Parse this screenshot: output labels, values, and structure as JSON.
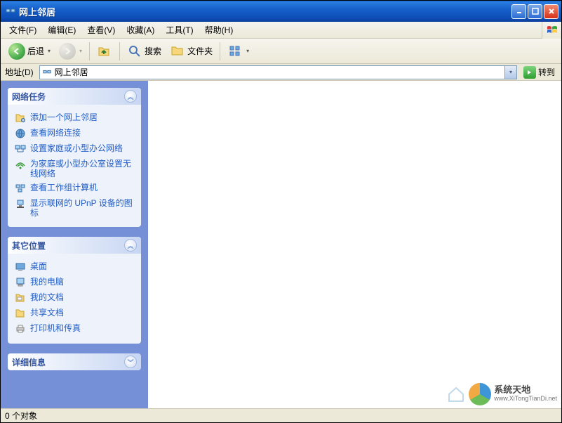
{
  "titlebar": {
    "title": "网上邻居"
  },
  "menu": {
    "file": "文件(F)",
    "edit": "编辑(E)",
    "view": "查看(V)",
    "favorites": "收藏(A)",
    "tools": "工具(T)",
    "help": "帮助(H)"
  },
  "toolbar": {
    "back": "后退",
    "search": "搜索",
    "folders": "文件夹"
  },
  "addressbar": {
    "label": "地址(D)",
    "value": "网上邻居",
    "go": "转到"
  },
  "panels": {
    "network": {
      "title": "网络任务",
      "items": [
        "添加一个网上邻居",
        "查看网络连接",
        "设置家庭或小型办公网络",
        "为家庭或小型办公室设置无线网络",
        "查看工作组计算机",
        "显示联网的 UPnP 设备的图标"
      ]
    },
    "other": {
      "title": "其它位置",
      "items": [
        "桌面",
        "我的电脑",
        "我的文档",
        "共享文档",
        "打印机和传真"
      ]
    },
    "details": {
      "title": "详细信息"
    }
  },
  "statusbar": {
    "text": "0 个对象"
  },
  "watermark": {
    "cn": "系统天地",
    "en": "www.XiTongTianDi.net"
  }
}
